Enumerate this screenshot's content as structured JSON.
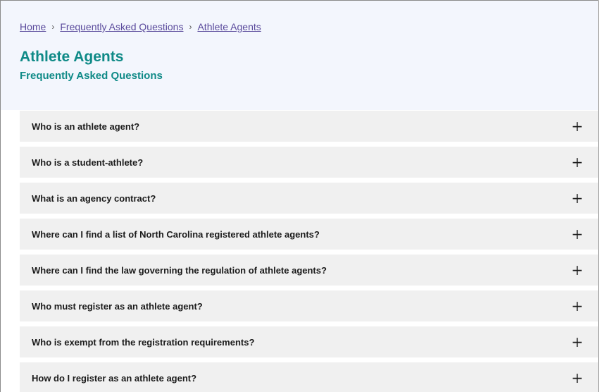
{
  "breadcrumb": {
    "items": [
      "Home",
      "Frequently Asked Questions",
      "Athlete Agents"
    ],
    "separator": "›"
  },
  "page": {
    "title": "Athlete Agents",
    "subtitle": "Frequently Asked Questions"
  },
  "faq": {
    "expand_icon": "+",
    "items": [
      "Who is an athlete agent?",
      "Who is a student-athlete?",
      "What is an agency contract?",
      "Where can I find a list of North Carolina registered athlete agents?",
      "Where can I find the law governing the regulation of athlete agents?",
      "Who must register as an athlete agent?",
      "Who is exempt from the registration requirements?",
      "How do I register as an athlete agent?"
    ]
  },
  "colors": {
    "accent": "#0f8a87",
    "link": "#5a4a9c",
    "header_background": "#f3f6fd",
    "item_background": "#f0f0f0"
  }
}
